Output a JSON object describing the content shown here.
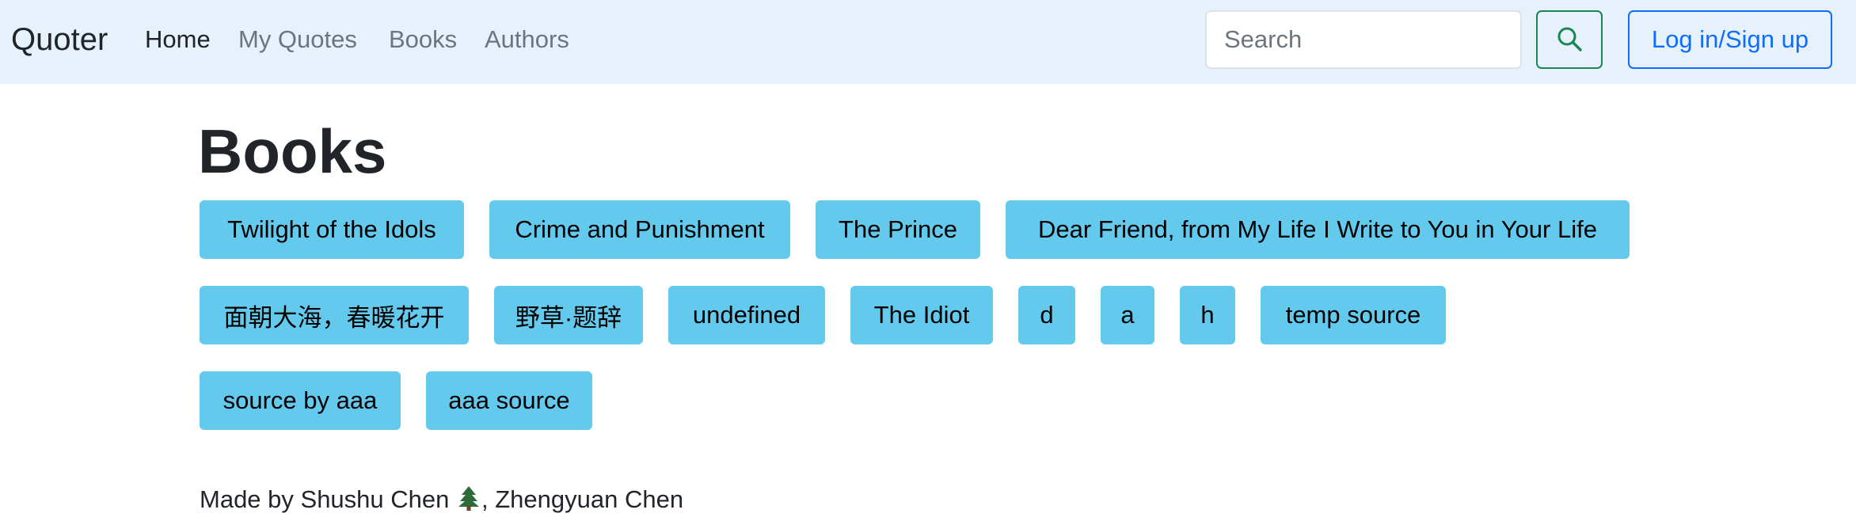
{
  "navbar": {
    "brand": "Quoter",
    "links": [
      {
        "label": "Home",
        "active": true
      },
      {
        "label": "My Quotes",
        "active": false
      },
      {
        "label": "Books",
        "active": false
      },
      {
        "label": "Authors",
        "active": false
      }
    ],
    "search": {
      "placeholder": "Search",
      "value": "",
      "button_icon": "search-icon"
    },
    "login_label": "Log in/Sign up"
  },
  "main": {
    "title": "Books",
    "books": [
      "Twilight of the Idols",
      "Crime and Punishment",
      "The Prince",
      "Dear Friend, from My Life I Write to You in Your Life",
      "面朝大海，春暖花开",
      "野草·题辞",
      "undefined",
      "The Idiot",
      "d",
      "a",
      "h",
      "temp source",
      "source by aaa",
      "aaa source"
    ]
  },
  "footer": {
    "text_before": "Made by Shushu Chen ",
    "icon": "evergreen-tree-icon",
    "text_after": ", Zhengyuan Chen"
  },
  "colors": {
    "navbar_bg": "#e7f1fb",
    "book_pill": "#63caed",
    "search_button": "#198754",
    "login_button": "#0d6efd"
  }
}
